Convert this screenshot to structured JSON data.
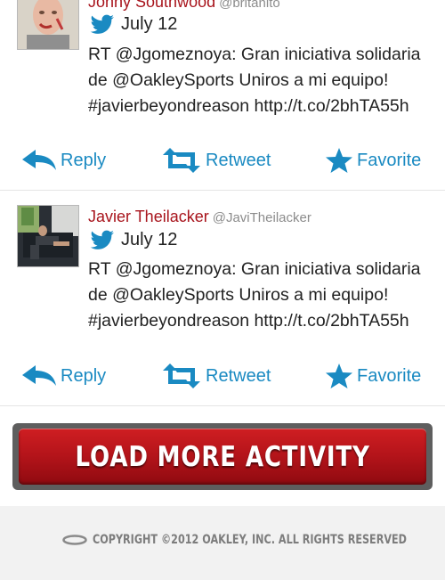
{
  "tweets": [
    {
      "name": "Jonny Southwood",
      "handle": "@britanito",
      "date": "July 12",
      "text": "RT @Jgomeznoya: Gran iniciativa solidaria de @OakleySports Uniros a mi equipo! #javierbeyondreason http://t.co/2bhTA55h"
    },
    {
      "name": "Javier Theilacker",
      "handle": "@JaviTheilacker",
      "date": "July 12",
      "text": "RT @Jgomeznoya: Gran iniciativa solidaria de @OakleySports Uniros a mi equipo! #javierbeyondreason http://t.co/2bhTA55h"
    }
  ],
  "actions": {
    "reply": "Reply",
    "retweet": "Retweet",
    "favorite": "Favorite"
  },
  "load_more": "LOAD MORE ACTIVITY",
  "footer": {
    "copyright": "COPYRIGHT ©2012 OAKLEY, INC. ALL RIGHTS RESERVED"
  },
  "colors": {
    "name": "#a8141c",
    "action": "#1a8ac2",
    "button": "#b4141a"
  }
}
